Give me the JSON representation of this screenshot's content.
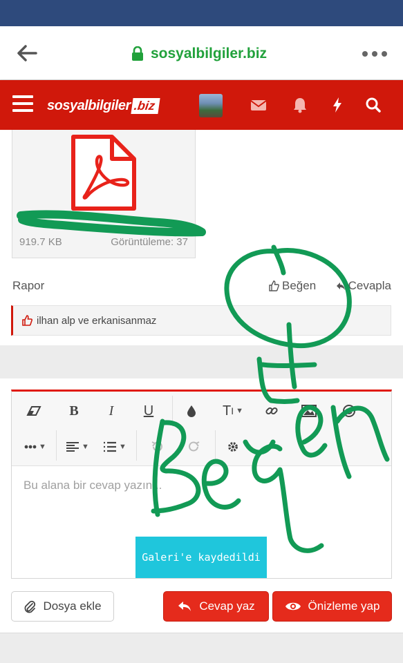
{
  "browser": {
    "url": "sosyalbilgiler.biz"
  },
  "site": {
    "logo_main": "sosyalbilgiler",
    "logo_tld": ".biz"
  },
  "attachment": {
    "size": "919.7 KB",
    "views": "Görüntüleme: 37"
  },
  "post_actions": {
    "report": "Rapor",
    "like": "Beğen",
    "reply": "Cevapla"
  },
  "likes": {
    "text": "ilhan alp ve erkanisanmaz"
  },
  "editor": {
    "placeholder": "Bu alana bir cevap yazın..."
  },
  "buttons": {
    "attach_file": "Dosya ekle",
    "post_reply": "Cevap yaz",
    "preview": "Önizleme yap"
  },
  "toast": {
    "text": "Galeri'e kaydedildi"
  },
  "colors": {
    "brand_red": "#d0180b",
    "url_green": "#21a13b",
    "status_blue": "#2e4a7c",
    "scribble_green": "#129a55",
    "toast_cyan": "#1fc6dc"
  }
}
